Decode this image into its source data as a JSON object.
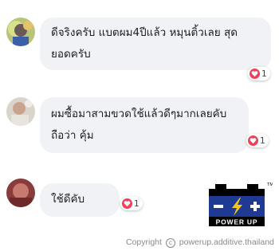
{
  "comments": [
    {
      "lines": [
        "ดีจริงครับ แบตผม4ปีแล้ว หมุนติ้วเลย สุด",
        "ยอดครับ"
      ],
      "reaction_count": "1",
      "reaction_icon": "heart-icon"
    },
    {
      "lines": [
        "ผมซื้อมาสามขวดใช้แล้วดีๆมากเลยคับ",
        "ถือว่า คุ้ม"
      ],
      "reaction_count": "1",
      "reaction_icon": "heart-icon"
    },
    {
      "lines": [
        "ใช้ดีคับ"
      ],
      "reaction_count": "1",
      "reaction_icon": "heart-icon"
    }
  ],
  "logo": {
    "text": "POWER UP",
    "trademark": "TM",
    "minus": "−",
    "plus": "+"
  },
  "footer": {
    "copyright_word": "Copyright",
    "copyright_symbol": "c",
    "handle": "powerup.additive.thailand"
  },
  "colors": {
    "bubble": "#f0f2f5",
    "heart": "#f33e58",
    "logo_navy": "#1f3a93",
    "logo_yellow": "#f5c518"
  }
}
